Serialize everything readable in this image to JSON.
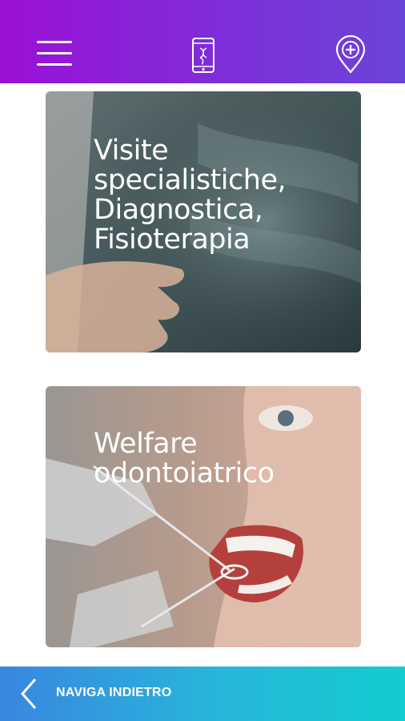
{
  "header": {
    "menu_icon": "hamburger-menu-icon",
    "center_icon": "smartphone-icon",
    "right_icon": "location-pin-plus-icon",
    "gradient": [
      "#9b10d6",
      "#6b44d8"
    ]
  },
  "cards": [
    {
      "title": "Visite\nspecialistiche,\nDiagnostica,\nFisioterapia",
      "image": "x-ray-scan"
    },
    {
      "title": "Welfare\nodontoiatrico",
      "image": "dental-checkup"
    }
  ],
  "footer": {
    "back_icon": "chevron-left-icon",
    "label": "NAVIGA INDIETRO",
    "gradient": [
      "#3a86e0",
      "#12ccd0"
    ]
  }
}
